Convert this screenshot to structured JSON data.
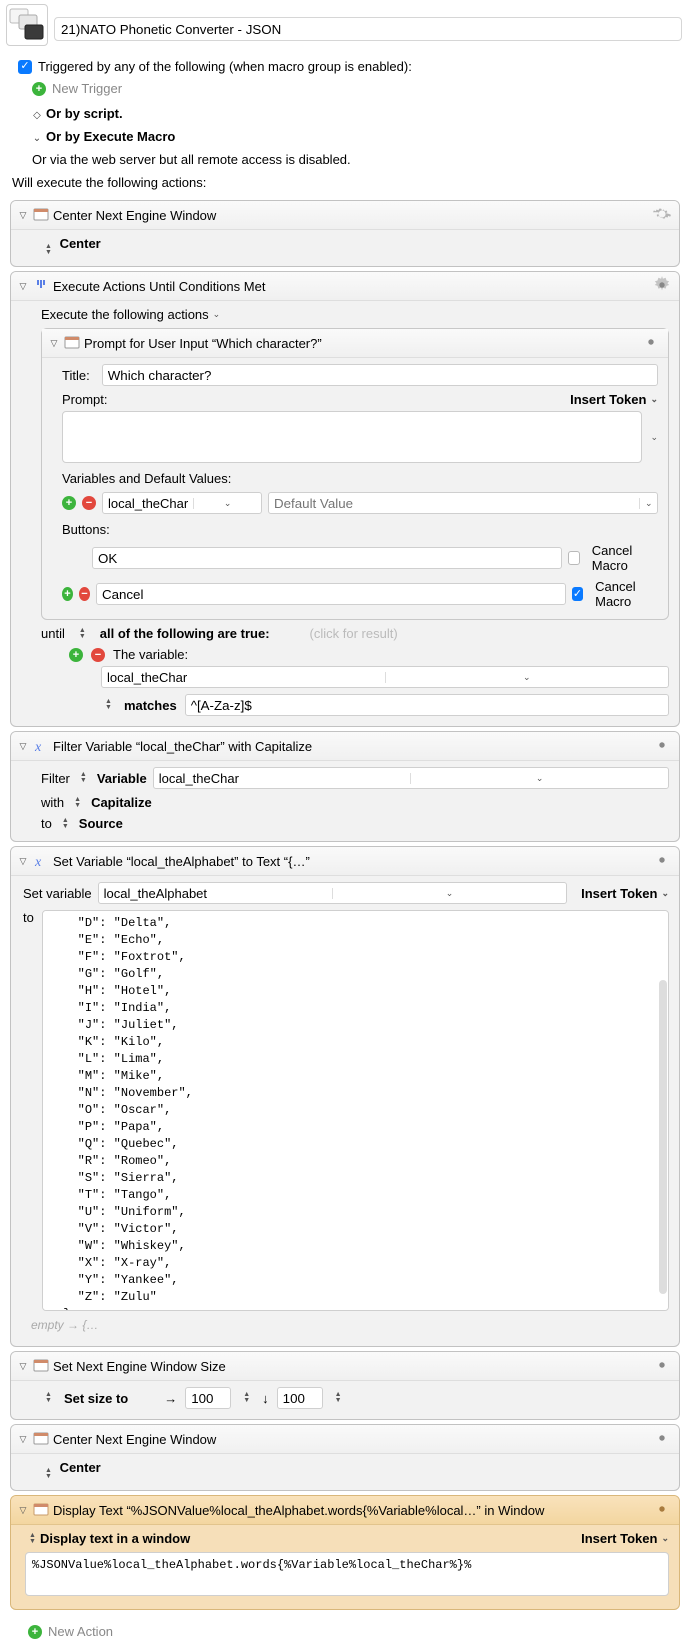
{
  "macro_title": "21)NATO Phonetic Converter - JSON",
  "triggered_label": "Triggered by any of the following (when macro group is enabled):",
  "new_trigger": "New Trigger",
  "or_script": "Or by script.",
  "or_execute": "Or by Execute Macro",
  "or_web": "Or via the web server but all remote access is disabled.",
  "will_execute": "Will execute the following actions:",
  "center_title": "Center Next Engine Window",
  "center_label": "Center",
  "loop_title": "Execute Actions Until Conditions Met",
  "exec_following": "Execute the following actions",
  "prompt_title": "Prompt for User Input “Which character?”",
  "title_label": "Title:",
  "title_value": "Which character?",
  "prompt_label": "Prompt:",
  "insert_token": "Insert Token",
  "vars_label": "Variables and Default Values:",
  "var_name": "local_theChar",
  "default_ph": "Default Value",
  "buttons_label": "Buttons:",
  "btn_ok": "OK",
  "btn_cancel": "Cancel",
  "cancel_macro": "Cancel Macro",
  "until": "until",
  "all_true": "all of the following are true:",
  "click_result": "(click for result)",
  "the_variable": "The variable:",
  "cond_var": "local_theChar",
  "matches": "matches",
  "regex": "^[A-Za-z]$",
  "filter_title": "Filter Variable “local_theChar” with Capitalize",
  "filter_word": "Filter",
  "variable_word": "Variable",
  "filter_var": "local_theChar",
  "with": "with",
  "capitalize": "Capitalize",
  "to": "to",
  "source": "Source",
  "setvar_title": "Set Variable “local_theAlphabet” to Text “{…”",
  "set_variable": "Set variable",
  "alphabet_var": "local_theAlphabet",
  "alphabet_json": "    \"D\": \"Delta\",\n    \"E\": \"Echo\",\n    \"F\": \"Foxtrot\",\n    \"G\": \"Golf\",\n    \"H\": \"Hotel\",\n    \"I\": \"India\",\n    \"J\": \"Juliet\",\n    \"K\": \"Kilo\",\n    \"L\": \"Lima\",\n    \"M\": \"Mike\",\n    \"N\": \"November\",\n    \"O\": \"Oscar\",\n    \"P\": \"Papa\",\n    \"Q\": \"Quebec\",\n    \"R\": \"Romeo\",\n    \"S\": \"Sierra\",\n    \"T\": \"Tango\",\n    \"U\": \"Uniform\",\n    \"V\": \"Victor\",\n    \"W\": \"Whiskey\",\n    \"X\": \"X-ray\",\n    \"Y\": \"Yankee\",\n    \"Z\": \"Zulu\"\n  }\n}",
  "empty_hint": "empty → {…",
  "setsize_title": "Set Next Engine Window Size",
  "setsize_label": "Set size to",
  "width": "100",
  "height": "100",
  "display_title": "Display Text “%JSONValue%local_theAlphabet.words{%Variable%local…” in Window",
  "display_mode": "Display text in a window",
  "display_text": "%JSONValue%local_theAlphabet.words{%Variable%local_theChar%}%",
  "new_action": "New Action",
  "chart_data": null
}
